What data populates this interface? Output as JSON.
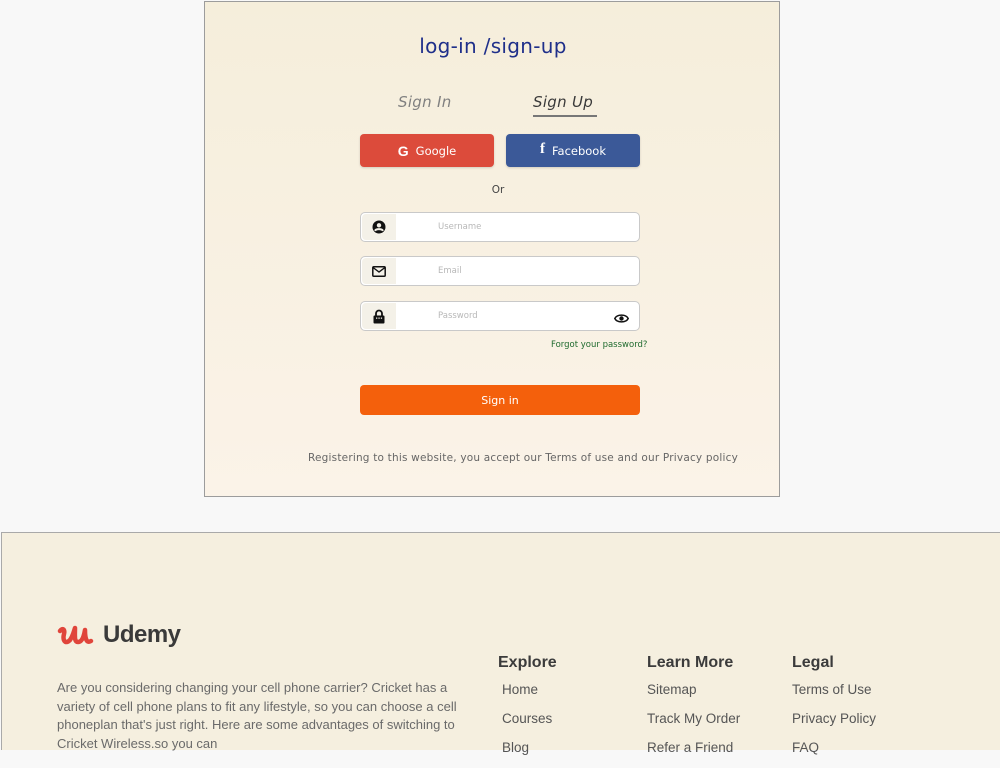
{
  "auth": {
    "title": "log-in /sign-up",
    "tabs": {
      "sign_in": "Sign In",
      "sign_up": "Sign Up",
      "active": "sign_up"
    },
    "social": {
      "google_label": "Google",
      "facebook_label": "Facebook"
    },
    "divider": "Or",
    "fields": {
      "username": {
        "placeholder": "Username",
        "value": "",
        "icon": "user-circle-icon"
      },
      "email": {
        "placeholder": "Email",
        "value": "",
        "icon": "envelope-icon"
      },
      "password": {
        "placeholder": "Password",
        "value": "",
        "icon": "lock-icon",
        "toggle_icon": "eye-icon"
      }
    },
    "forgot_password": "Forgot your password?",
    "submit_label": "Sign in",
    "terms": "Registering to this website, you accept our Terms of use and our Privacy policy",
    "colors": {
      "title": "#1f2f8a",
      "google": "#dc4b3b",
      "facebook": "#3b5998",
      "submit": "#f4600c",
      "forgot": "#1f6b2e"
    }
  },
  "footer": {
    "brand": "Udemy",
    "brand_color": "#e0453b",
    "about": "Are you considering changing your cell phone carrier? Cricket has a variety of cell phone plans to fit any lifestyle, so you can choose a cell phoneplan that's just right. Here are some advantages of switching to Cricket Wireless.so you can",
    "columns": [
      {
        "heading": "Explore",
        "links": [
          "Home",
          "Courses",
          "Blog"
        ]
      },
      {
        "heading": "Learn More",
        "links": [
          "Sitemap",
          "Track My Order",
          "Refer a Friend"
        ]
      },
      {
        "heading": "Legal",
        "links": [
          "Terms of Use",
          "Privacy Policy",
          "FAQ"
        ]
      }
    ]
  }
}
